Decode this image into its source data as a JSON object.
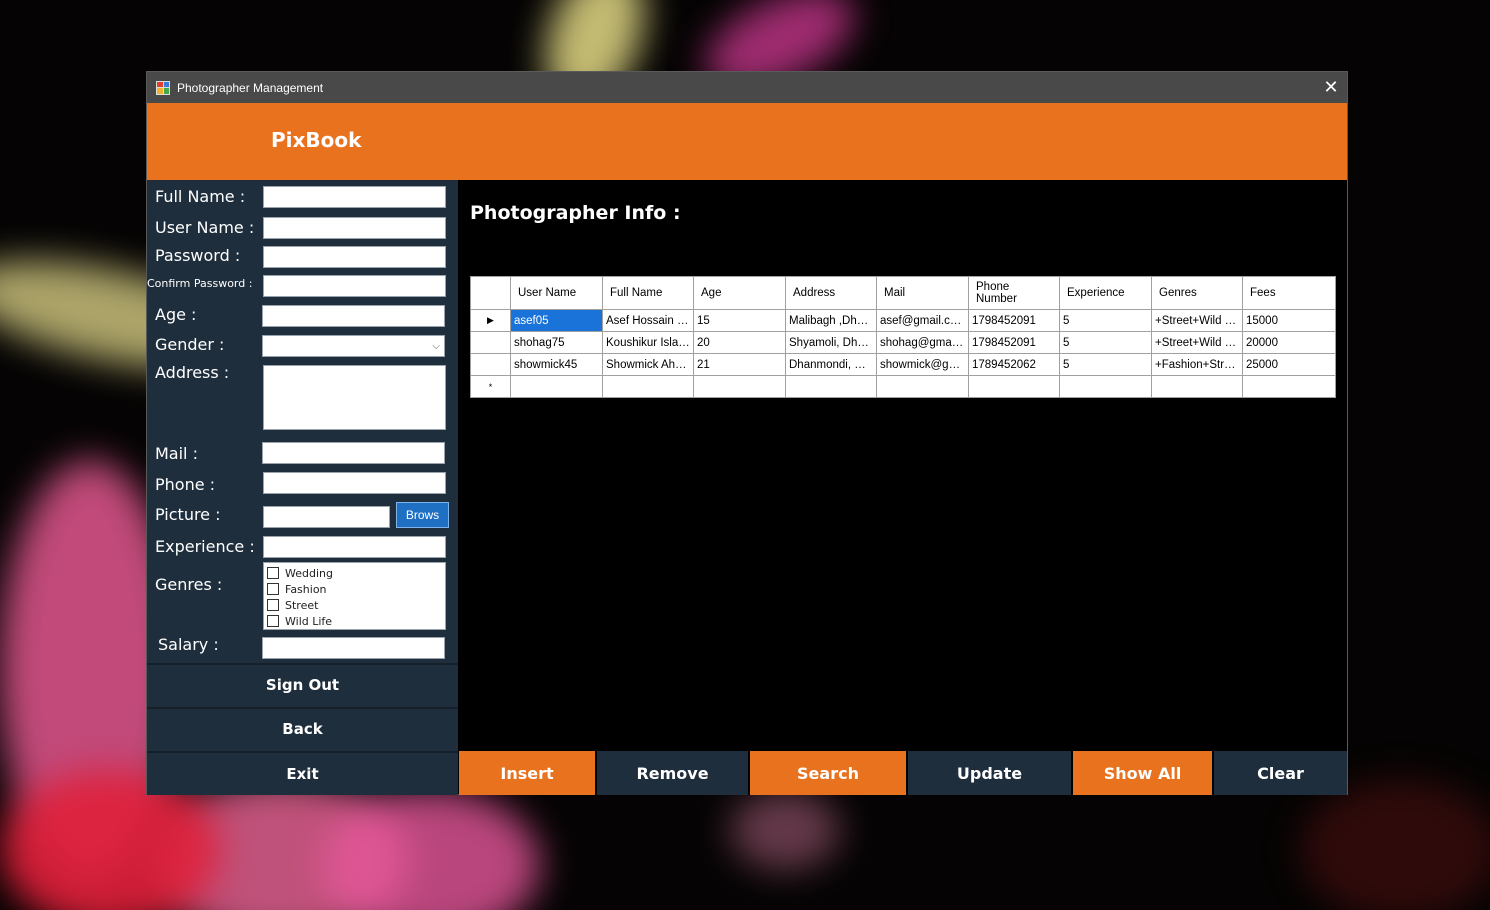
{
  "window": {
    "title": "Photographer Management",
    "close_glyph": "✕"
  },
  "banner": {
    "brand": "PixBook"
  },
  "form": {
    "full_name_label": "Full Name :",
    "user_name_label": "User Name :",
    "password_label": "Password :",
    "confirm_password_label": "Confirm Password :",
    "age_label": "Age :",
    "gender_label": "Gender :",
    "address_label": "Address :",
    "mail_label": "Mail :",
    "phone_label": "Phone :",
    "picture_label": "Picture :",
    "browse_label": "Brows",
    "experience_label": "Experience :",
    "genres_label": "Genres :",
    "salary_label": "Salary :",
    "genres": [
      "Wedding",
      "Fashion",
      "Street",
      "Wild Life"
    ]
  },
  "side_buttons": {
    "sign_out": "Sign Out",
    "back": "Back",
    "exit": "Exit"
  },
  "info": {
    "title": "Photographer Info :"
  },
  "grid": {
    "columns": [
      "User Name",
      "Full Name",
      "Age",
      "Address",
      "Mail",
      "Phone Number",
      "Experience",
      "Genres",
      "Fees"
    ],
    "rows": [
      [
        "asef05",
        "Asef Hossain K...",
        "15",
        "Malibagh ,Dhaka",
        "asef@gmail.com",
        "1798452091",
        "5",
        "+Street+Wild Life",
        "15000"
      ],
      [
        "shohag75",
        "Koushikur Islam...",
        "20",
        "Shyamoli, Dhaka",
        "shohag@gmail....",
        "1798452091",
        "5",
        "+Street+Wild Life",
        "20000"
      ],
      [
        "showmick45",
        "Showmick Ahm...",
        "21",
        "Dhanmondi, Dh...",
        "showmick@gm...",
        "1789452062",
        "5",
        "+Fashion+Street",
        "25000"
      ]
    ],
    "current_row_glyph": "▶",
    "new_row_glyph": "*"
  },
  "actions": {
    "insert": "Insert",
    "remove": "Remove",
    "search": "Search",
    "update": "Update",
    "show_all": "Show All",
    "clear": "Clear"
  },
  "colors": {
    "accent_orange": "#e8721e",
    "panel_dark": "#1f2e3d",
    "selection_blue": "#1a73d9"
  },
  "icons": {
    "app": "app-icon",
    "close": "close-icon",
    "dropdown": "chevron-down-icon"
  }
}
